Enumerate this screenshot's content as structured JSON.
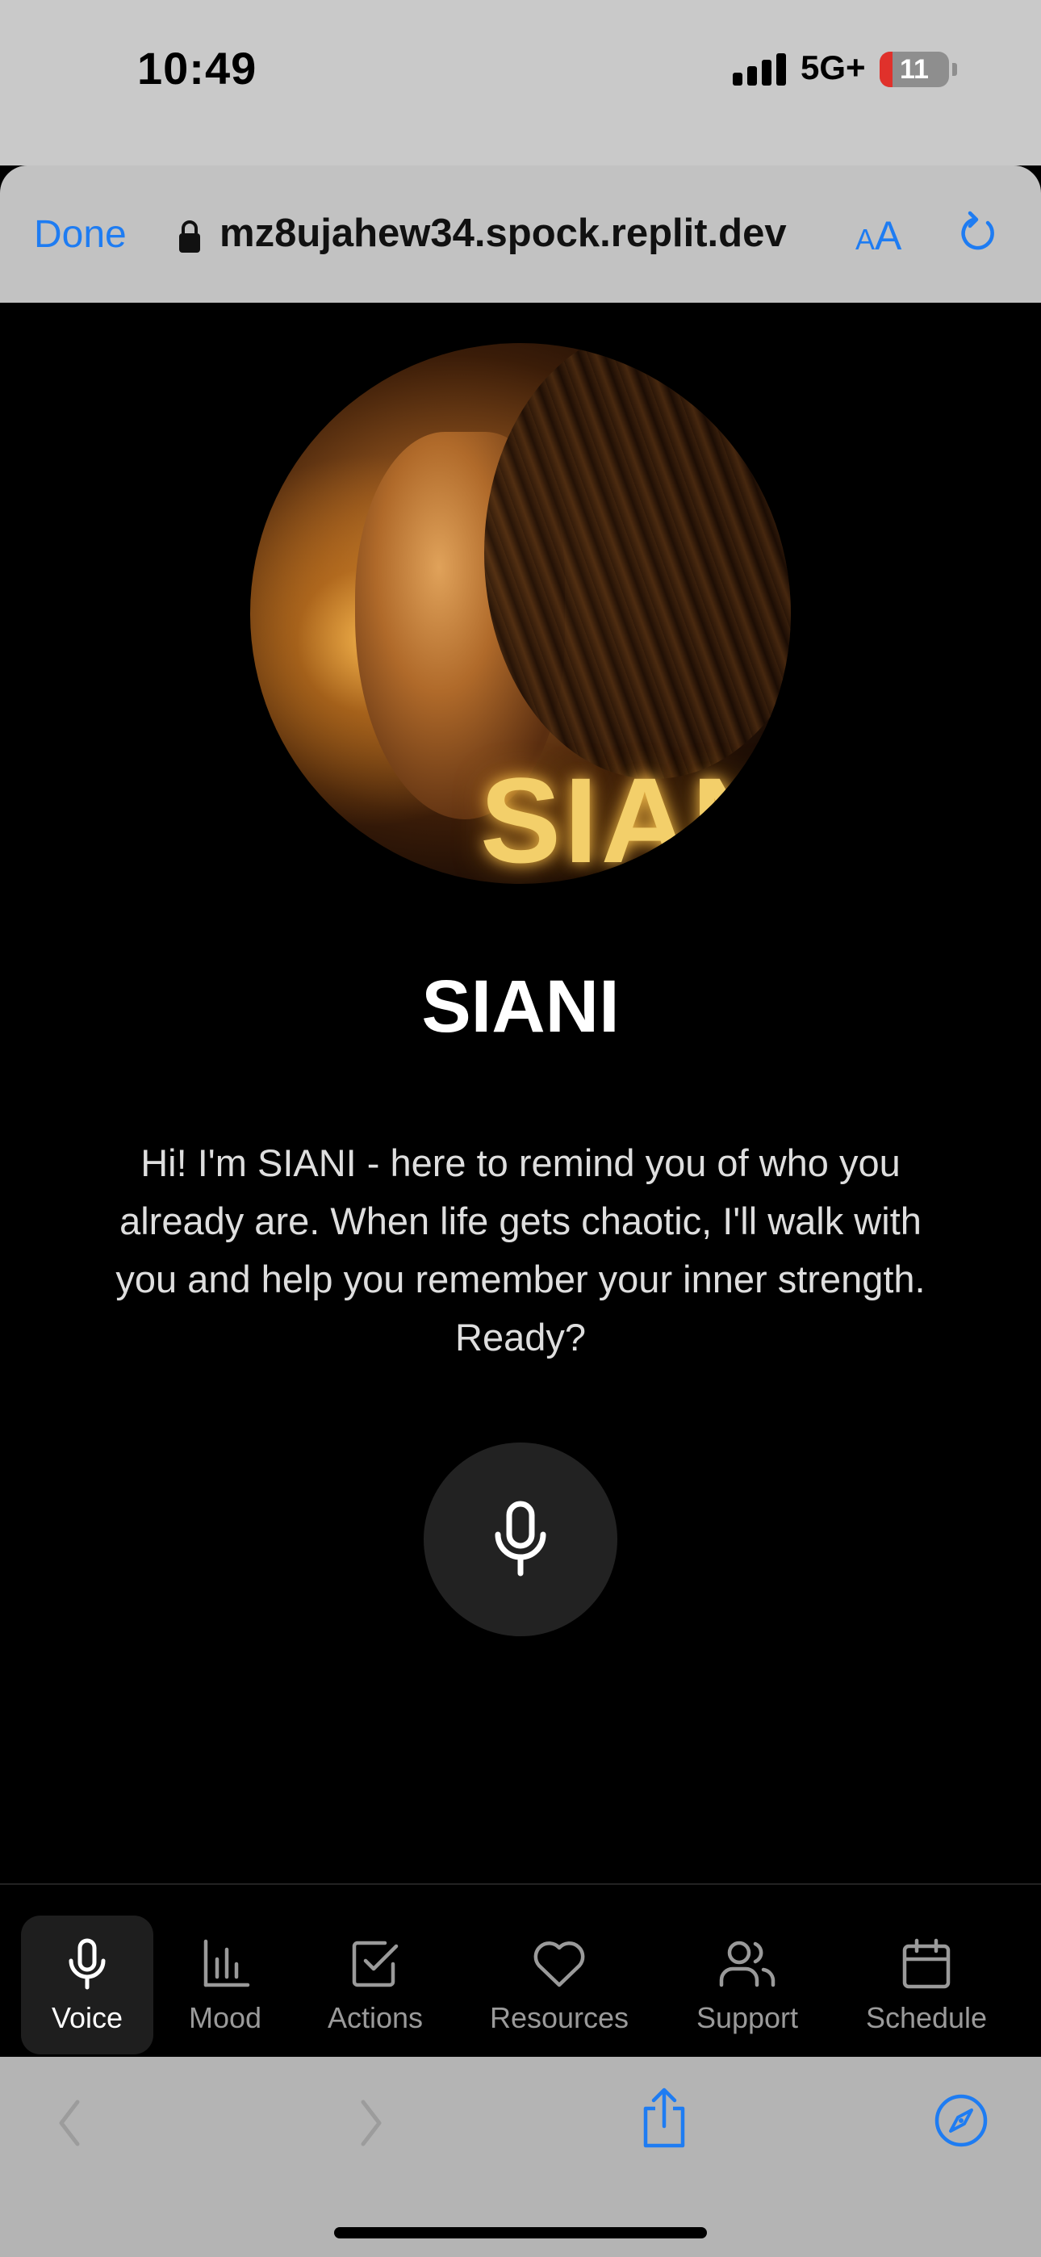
{
  "status_bar": {
    "time": "10:49",
    "network": "5G+",
    "battery": "11"
  },
  "browser": {
    "done_label": "Done",
    "url": "mz8ujahew34.spock.replit.dev",
    "text_size_small": "A",
    "text_size_big": "A"
  },
  "profile": {
    "logo_text": "SIANI",
    "title": "SIANI",
    "intro": "Hi! I'm SIANI - here to remind you of who you already are. When life gets chaotic, I'll walk with you and help you remember your inner strength. Ready?"
  },
  "tabs": [
    {
      "label": "Voice",
      "icon": "mic-icon",
      "active": true
    },
    {
      "label": "Mood",
      "icon": "bar-chart-icon",
      "active": false
    },
    {
      "label": "Actions",
      "icon": "checkbox-icon",
      "active": false
    },
    {
      "label": "Resources",
      "icon": "heart-icon",
      "active": false
    },
    {
      "label": "Support",
      "icon": "users-icon",
      "active": false
    },
    {
      "label": "Schedule",
      "icon": "calendar-icon",
      "active": false
    }
  ],
  "colors": {
    "accent": "#1e7cf2",
    "background": "#000000",
    "active_tab": "#1e1e1e",
    "mic_button": "#222222"
  }
}
